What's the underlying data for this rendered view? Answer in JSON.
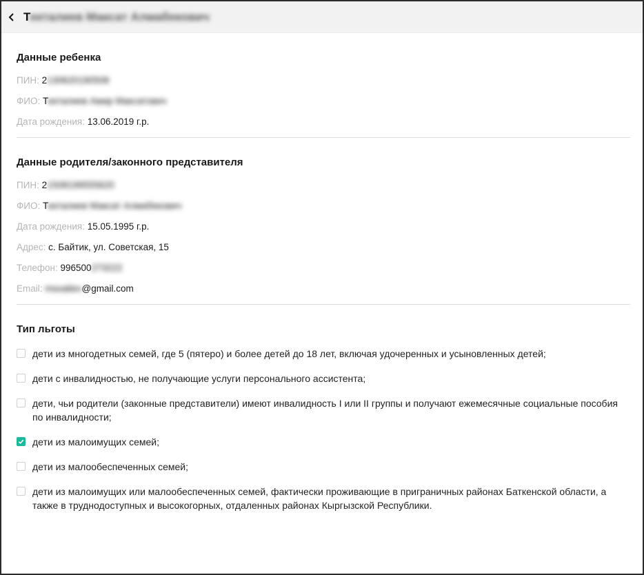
{
  "header": {
    "title_visible": "Т",
    "title_blurred": "екталиев Максат Алмабекович"
  },
  "child": {
    "title": "Данные ребенка",
    "pin": {
      "label": "ПИН: ",
      "visible": "2",
      "blurred": "130620190508"
    },
    "fio": {
      "label": "ФИО: ",
      "visible": "Т",
      "blurred": "екталиев Амир Максатович"
    },
    "dob": {
      "label": "Дата рождения: ",
      "value": "13.06.2019 г.р."
    }
  },
  "parent": {
    "title": "Данные родителя/законного представителя",
    "pin": {
      "label": "ПИН: ",
      "visible": "2",
      "blurred": "1508199555620"
    },
    "fio": {
      "label": "ФИО: ",
      "visible": "Т",
      "blurred": "екталиев Максат Алмабекович"
    },
    "dob": {
      "label": "Дата рождения: ",
      "value": "15.05.1995 г.р."
    },
    "address": {
      "label": "Адрес: ",
      "value": "с. Байтик, ул. Советская, 15"
    },
    "phone": {
      "label": "Телефон: ",
      "visible": "996500",
      "blurred": "273222"
    },
    "email": {
      "label": "Email: ",
      "blurred": "msoaliev",
      "visible": "@gmail.com"
    }
  },
  "benefits": {
    "title": "Тип льготы",
    "items": [
      {
        "text": "дети из многодетных семей, где 5 (пятеро) и более детей до 18 лет, включая удочеренных и усыновленных детей;",
        "checked": false
      },
      {
        "text": "дети с инвалидностью, не получающие услуги персонального ассистента;",
        "checked": false
      },
      {
        "text": "дети, чьи родители (законные представители) имеют инвалидность I или II группы и получают ежемесячные социальные пособия по инвалидности;",
        "checked": false
      },
      {
        "text": "дети из малоимущих семей;",
        "checked": true
      },
      {
        "text": "дети из малообеспеченных семей;",
        "checked": false
      },
      {
        "text": "дети из малоимущих или малообеспеченных семей, фактически проживающие в приграничных районах Баткенской области, а также в труднодоступных и высокогорных, отдаленных районах Кыргызской Республики.",
        "checked": false
      }
    ]
  },
  "icons": {
    "back": "chevron-left-icon",
    "check": "checkmark-icon"
  },
  "colors": {
    "accent": "#1bb99a",
    "label": "#b5b5b5",
    "header_bg": "#f2f2f2"
  }
}
